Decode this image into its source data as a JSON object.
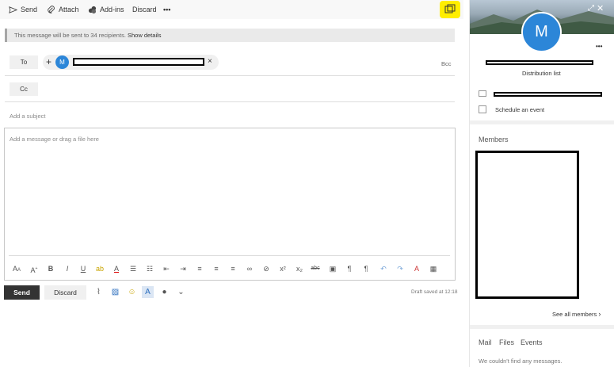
{
  "toolbar": {
    "send": "Send",
    "attach": "Attach",
    "addins": "Add-ins",
    "discard": "Discard",
    "more": "•••"
  },
  "notice": {
    "text": "This message will be sent to 34 recipients.",
    "link": "Show details"
  },
  "to": {
    "label": "To",
    "add": "+",
    "avatar_initial": "M",
    "remove": "×",
    "bcc": "Bcc"
  },
  "cc": {
    "label": "Cc"
  },
  "subject": {
    "placeholder": "Add a subject"
  },
  "body": {
    "placeholder": "Add a message or drag a file here"
  },
  "format_icons": [
    "font-size-icon",
    "grow-font-icon",
    "bold-icon",
    "italic-icon",
    "underline-icon",
    "highlight-icon",
    "font-color-icon",
    "bullets-icon",
    "numbering-icon",
    "decrease-indent-icon",
    "increase-indent-icon",
    "align-left-icon",
    "align-center-icon",
    "align-right-icon",
    "link-icon",
    "unlink-icon",
    "superscript-icon",
    "subscript-icon",
    "strikethrough-icon",
    "image-icon",
    "ltr-icon",
    "rtl-icon",
    "undo-icon",
    "redo-icon",
    "clear-format-icon",
    "table-icon"
  ],
  "bottom": {
    "send": "Send",
    "discard": "Discard",
    "draft_status": "Draft saved at 12:18"
  },
  "panel": {
    "avatar_initial": "M",
    "more": "•••",
    "subtitle": "Distribution list",
    "schedule": "Schedule an event",
    "members_heading": "Members",
    "see_all": "See all members",
    "tabs": [
      "Mail",
      "Files",
      "Events"
    ],
    "no_messages": "We couldn't find any messages."
  },
  "colors": {
    "accent": "#2c86d8",
    "send_button": "#333333",
    "highlight": "#ffee00"
  }
}
